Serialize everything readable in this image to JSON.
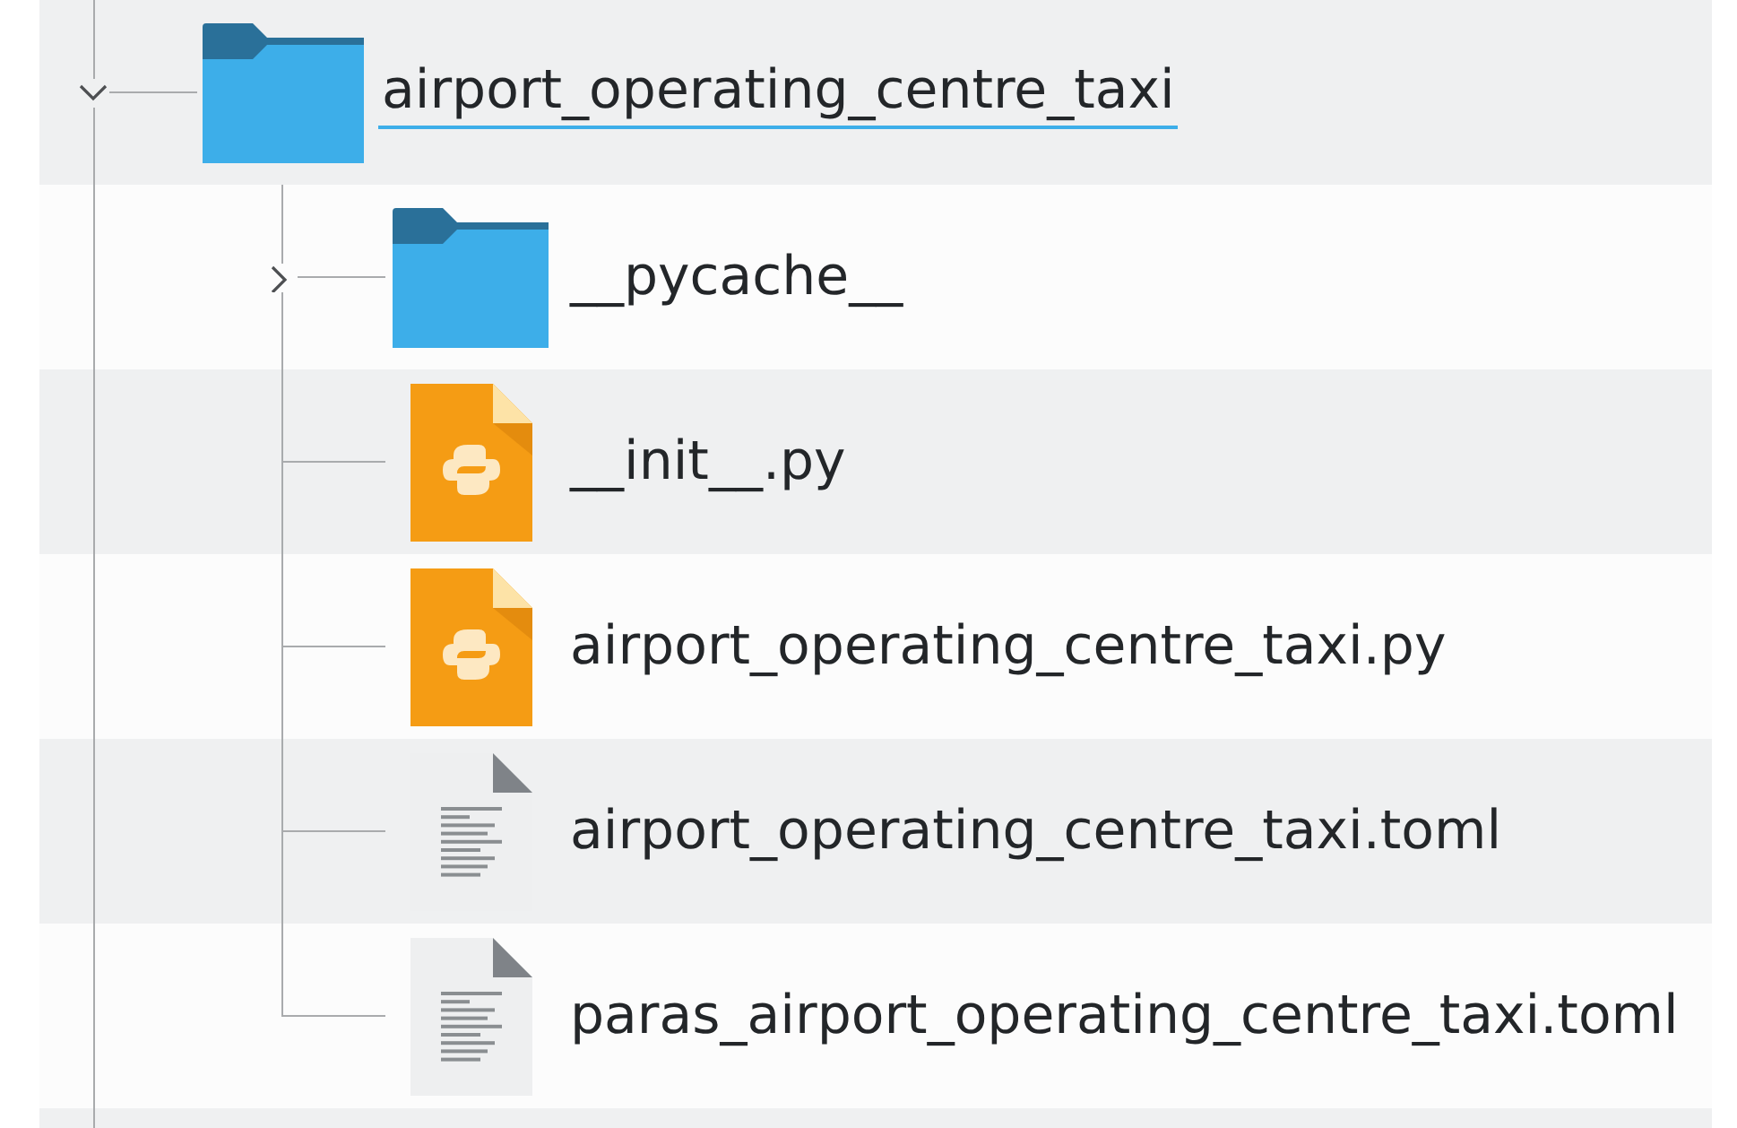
{
  "tree": [
    {
      "name": "airport_operating_centre_taxi",
      "kind": "folder",
      "expanded": true,
      "focused": true,
      "children": [
        {
          "name": "__pycache__",
          "kind": "folder",
          "expanded": false,
          "focused": false
        },
        {
          "name": "__init__.py",
          "kind": "python",
          "focused": false
        },
        {
          "name": "airport_operating_centre_taxi.py",
          "kind": "python",
          "focused": false
        },
        {
          "name": "airport_operating_centre_taxi.toml",
          "kind": "text",
          "focused": false
        },
        {
          "name": "paras_airport_operating_centre_taxi.toml",
          "kind": "text",
          "focused": false
        }
      ]
    }
  ]
}
